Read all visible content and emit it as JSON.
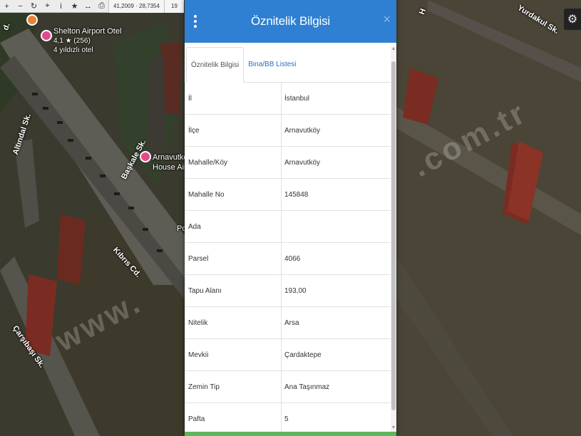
{
  "toolbar": {
    "buttons": [
      {
        "name": "zoom-in-button",
        "glyph": "+"
      },
      {
        "name": "zoom-out-button",
        "glyph": "−"
      },
      {
        "name": "refresh-button",
        "glyph": "↻"
      },
      {
        "name": "locate-button",
        "glyph": "⌖"
      },
      {
        "name": "info-button",
        "glyph": "i"
      },
      {
        "name": "favorite-button",
        "glyph": "★"
      },
      {
        "name": "measure-button",
        "glyph": "↔"
      },
      {
        "name": "print-button",
        "glyph": "⎙"
      }
    ],
    "coordinates": "41,2009 · 28,7354",
    "zoom_level": "19"
  },
  "map": {
    "street_labels": {
      "altindal": "Altındal Sk.",
      "baskale": "Başkale Sk.",
      "kibris": "Kıbrıs Cd.",
      "carsibasi": "Çarşıbaşı Sk.",
      "yurdakul": "Yurdakul Sk.",
      "corner_left": "d.",
      "corner_right": "H"
    },
    "pois": [
      {
        "name": "Shelton Airport Otel",
        "rating": "4,1 ★ (256)",
        "subtitle": "4 yıldızlı otel"
      },
      {
        "name": "Arnavutkoy",
        "subtitle": "House Airpo"
      }
    ],
    "fragment_label": "Po",
    "watermark_left": "www.",
    "watermark_right": ".com.tr",
    "icons": {
      "settings": "gear-icon"
    }
  },
  "modal": {
    "title": "Öznitelik Bilgisi",
    "close_glyph": "×",
    "tabs": [
      {
        "label": "Öznitelik Bilgisi",
        "active": true
      },
      {
        "label": "Bina/BB Listesi",
        "active": false
      }
    ],
    "rows": [
      {
        "key": "İl",
        "value": "İstanbul"
      },
      {
        "key": "İlçe",
        "value": "Arnavutköy"
      },
      {
        "key": "Mahalle/Köy",
        "value": "Arnavutköy"
      },
      {
        "key": "Mahalle No",
        "value": "145848"
      },
      {
        "key": "Ada",
        "value": ""
      },
      {
        "key": "Parsel",
        "value": "4066"
      },
      {
        "key": "Tapu Alanı",
        "value": "193,00"
      },
      {
        "key": "Nitelik",
        "value": "Arsa"
      },
      {
        "key": "Mevkii",
        "value": "Çardaktepe"
      },
      {
        "key": "Zemin Tip",
        "value": "Ana Taşınmaz"
      },
      {
        "key": "Pafta",
        "value": "5"
      }
    ],
    "colors": {
      "header": "#2f7fd2",
      "footer": "#5cb85c",
      "tab_link": "#2a6fbf"
    }
  }
}
